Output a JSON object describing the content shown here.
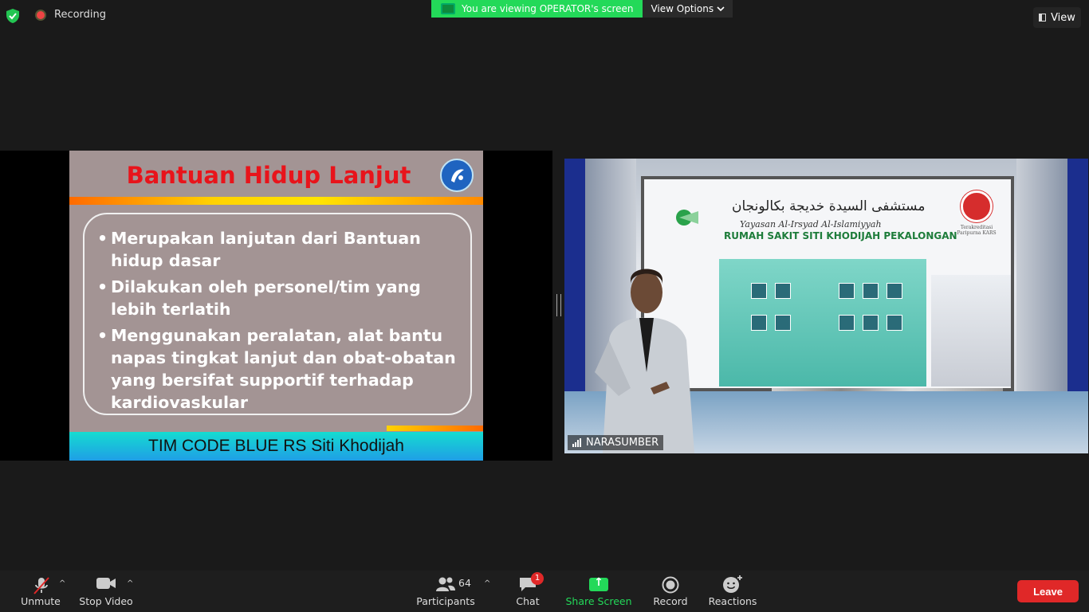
{
  "top": {
    "recording_label": "Recording",
    "banner_text": "You are viewing OPERATOR's screen",
    "view_options_label": "View Options",
    "view_label": "View"
  },
  "slide": {
    "title": "Bantuan Hidup Lanjut",
    "bullets": [
      "Merupakan lanjutan dari Bantuan hidup dasar",
      "Dilakukan oleh personel/tim yang lebih terlatih",
      "Menggunakan peralatan, alat bantu napas tingkat lanjut dan obat-obatan yang bersifat supportif terhadap kardiovaskular"
    ],
    "footer": "TIM CODE BLUE RS Siti Khodijah"
  },
  "video": {
    "background_arabic": "مستشفى السيدة خديجة بكالونجان",
    "background_yayasan": "Yayasan Al-Irsyad Al-Islamiyyah",
    "background_rs": "RUMAH SAKIT SITI KHODIJAH PEKALONGAN",
    "background_kars": "Terakreditasi Paripurna KARS",
    "participant_name": "NARASUMBER"
  },
  "toolbar": {
    "unmute": "Unmute",
    "stop_video": "Stop Video",
    "participants_count": "64",
    "participants": "Participants",
    "chat": "Chat",
    "chat_badge": "1",
    "share_screen": "Share Screen",
    "record": "Record",
    "reactions": "Reactions",
    "leave": "Leave"
  },
  "colors": {
    "share_green": "#23d959",
    "leave_red": "#e02828",
    "slide_title_red": "#e8141b"
  }
}
